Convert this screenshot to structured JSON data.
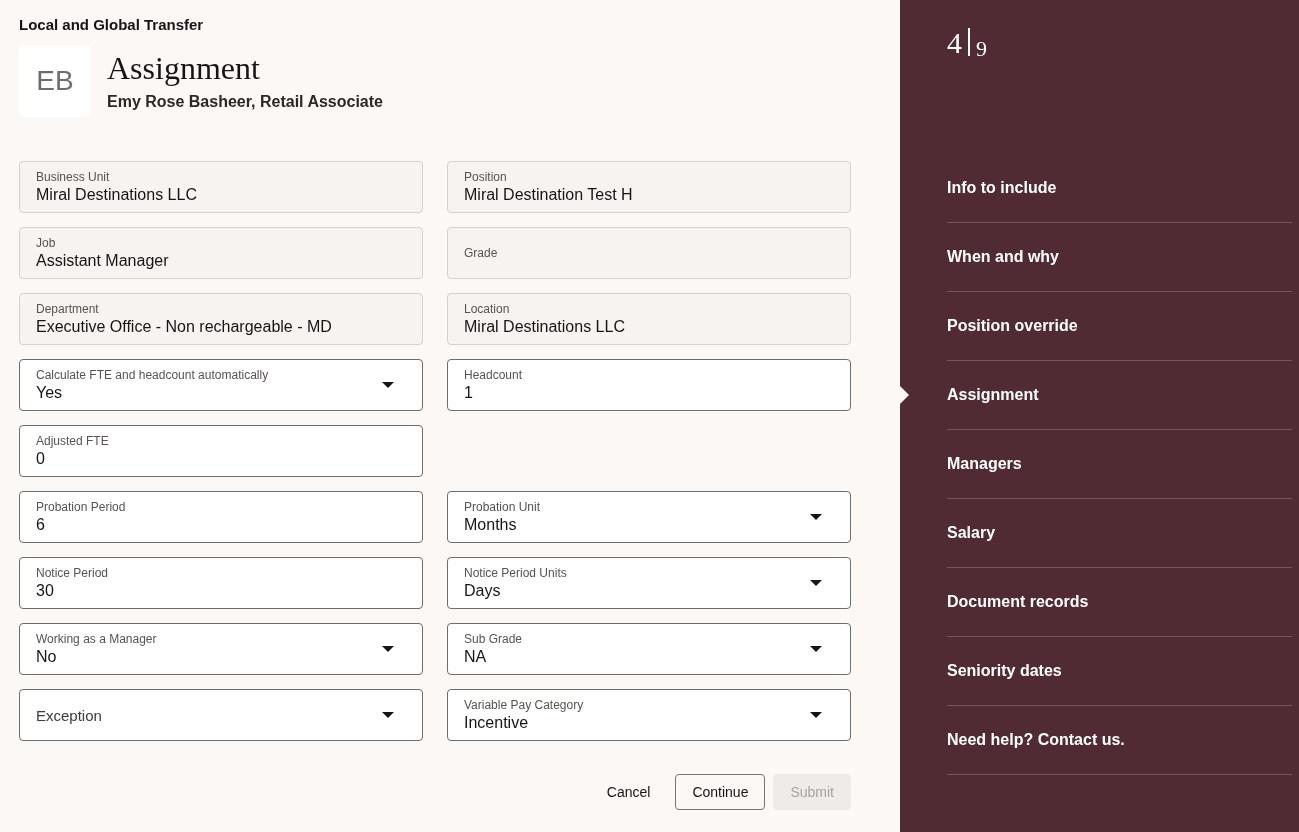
{
  "header": {
    "flow_title": "Local and Global Transfer",
    "avatar_initials": "EB",
    "title": "Assignment",
    "subtitle": "Emy Rose Basheer, Retail Associate"
  },
  "form_rows": [
    [
      {
        "kind": "readonly",
        "label": "Business Unit",
        "value": "Miral Destinations LLC"
      },
      {
        "kind": "readonly",
        "label": "Position",
        "value": "Miral Destination Test H"
      }
    ],
    [
      {
        "kind": "readonly",
        "label": "Job",
        "value": "Assistant Manager"
      },
      {
        "kind": "readonly",
        "label": "Grade"
      }
    ],
    [
      {
        "kind": "readonly",
        "label": "Department",
        "value": "Executive Office - Non rechargeable - MD"
      },
      {
        "kind": "readonly",
        "label": "Location",
        "value": "Miral Destinations LLC"
      }
    ],
    [
      {
        "kind": "select",
        "label": "Calculate FTE and headcount automatically",
        "value": "Yes"
      },
      {
        "kind": "input",
        "label": "Headcount",
        "value": "1"
      }
    ],
    [
      {
        "kind": "input",
        "label": "Adjusted FTE",
        "value": "0"
      }
    ],
    [
      {
        "kind": "input",
        "label": "Probation Period",
        "value": "6"
      },
      {
        "kind": "select",
        "label": "Probation Unit",
        "value": "Months"
      }
    ],
    [
      {
        "kind": "input",
        "label": "Notice Period",
        "value": "30"
      },
      {
        "kind": "select",
        "label": "Notice Period Units",
        "value": "Days"
      }
    ],
    [
      {
        "kind": "select",
        "label": "Working as a Manager",
        "value": "No"
      },
      {
        "kind": "select",
        "label": "Sub Grade",
        "value": "NA"
      }
    ],
    [
      {
        "kind": "select",
        "placeholder": "Exception"
      },
      {
        "kind": "select",
        "label": "Variable Pay Category",
        "value": "Incentive"
      }
    ]
  ],
  "buttons": [
    {
      "kind": "text",
      "label": "Cancel",
      "disabled": false
    },
    {
      "kind": "outlined",
      "label": "Continue",
      "disabled": false
    },
    {
      "kind": "filled",
      "label": "Submit",
      "disabled": true
    }
  ],
  "progress": {
    "current": "4",
    "total": "9"
  },
  "steps": [
    {
      "label": "Info to include",
      "selected": false
    },
    {
      "label": "When and why",
      "selected": false
    },
    {
      "label": "Position override",
      "selected": false
    },
    {
      "label": "Assignment",
      "selected": true
    },
    {
      "label": "Managers",
      "selected": false
    },
    {
      "label": "Salary",
      "selected": false
    },
    {
      "label": "Document records",
      "selected": false
    },
    {
      "label": "Seniority dates",
      "selected": false
    },
    {
      "label": "Need help? Contact us.",
      "selected": false
    }
  ]
}
